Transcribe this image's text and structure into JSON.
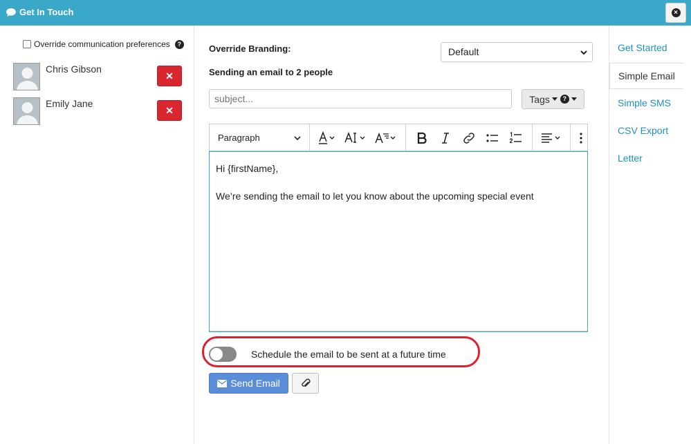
{
  "window": {
    "title": "Get In Touch"
  },
  "left": {
    "override_label": "Override communication preferences",
    "people": [
      {
        "name": "Chris Gibson",
        "remove_label": "✕"
      },
      {
        "name": "Emily Jane",
        "remove_label": "✕"
      }
    ]
  },
  "main": {
    "override_branding_label": "Override Branding:",
    "branding_value": "Default",
    "sending_label": "Sending an email to 2 people",
    "subject_placeholder": "subject...",
    "tags_label": "Tags",
    "editor": {
      "paragraph_style": "Paragraph",
      "body_lines": [
        "Hi {firstName},",
        "We’re sending the email to let you know about the upcoming special event"
      ]
    },
    "schedule_label": "Schedule the email to be sent at a future time",
    "schedule_enabled": false,
    "send_label": "Send Email"
  },
  "nav": {
    "items": [
      {
        "label": "Get Started",
        "active": false
      },
      {
        "label": "Simple Email",
        "active": true
      },
      {
        "label": "Simple SMS",
        "active": false
      },
      {
        "label": "CSV Export",
        "active": false
      },
      {
        "label": "Letter",
        "active": false
      }
    ]
  },
  "colors": {
    "titlebar": "#3aa8c8",
    "danger": "#d9262f",
    "primary": "#5b8dd9",
    "link": "#1f8fc2",
    "highlight": "#e0202c"
  }
}
